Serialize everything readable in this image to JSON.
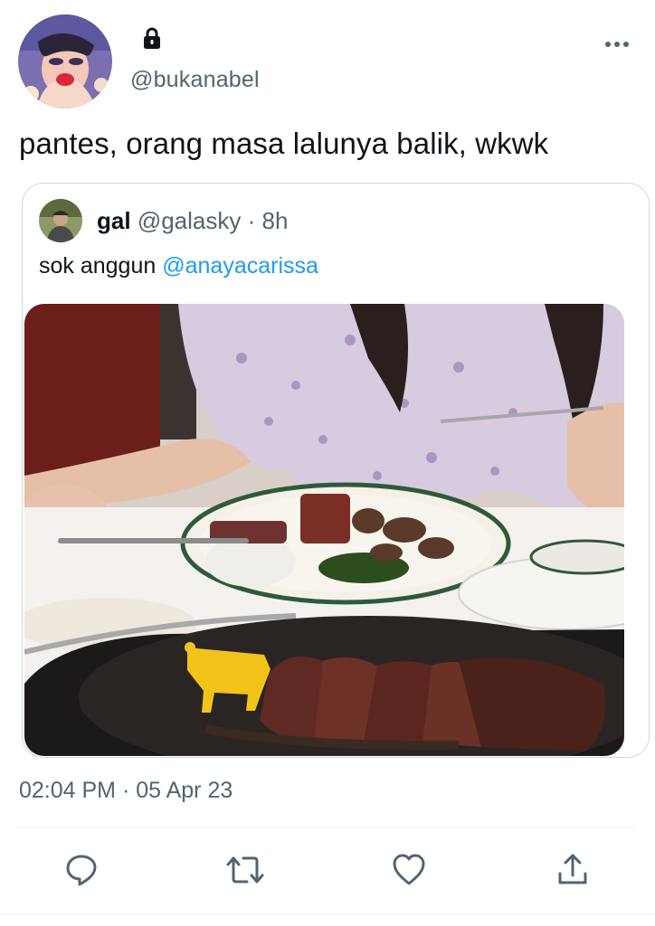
{
  "tweet": {
    "author_handle": "@bukanabel",
    "text": "pantes, orang masa lalunya balik, wkwk",
    "timestamp": "02:04 PM · 05 Apr 23",
    "protected_icon": "lock-icon",
    "menu_icon": "more-horizontal-icon"
  },
  "quoted": {
    "name": "gal",
    "handle": "@galasky",
    "separator": "·",
    "age": "8h",
    "text": "sok anggun",
    "mention": "@anayacarissa",
    "image_subject": "steak-dinner-photo"
  },
  "actions": [
    {
      "icon": "reply-icon"
    },
    {
      "icon": "retweet-icon"
    },
    {
      "icon": "like-icon"
    },
    {
      "icon": "share-icon"
    }
  ],
  "colors": {
    "text_primary": "#0f1419",
    "text_secondary": "#536471",
    "link": "#1d9bf0",
    "border": "#cfd9de"
  }
}
